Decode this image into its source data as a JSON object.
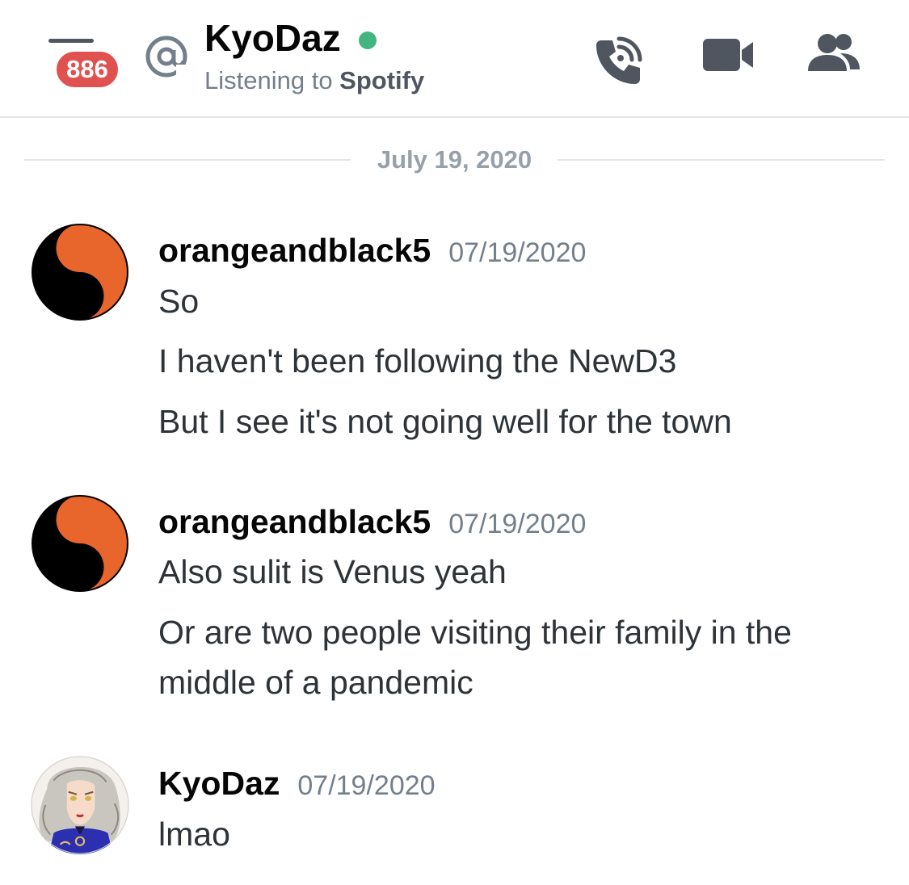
{
  "header": {
    "mention_count": "886",
    "title": "KyoDaz",
    "status_prefix": "Listening to ",
    "status_app": "Spotify",
    "status_color": "#43b581",
    "badge_color": "#e0524f",
    "icons": [
      "menu-icon",
      "at-icon",
      "phone-call-icon",
      "video-camera-icon",
      "members-icon"
    ]
  },
  "divider": {
    "date": "July 19, 2020"
  },
  "messages": [
    {
      "username": "orangeandblack5",
      "timestamp": "07/19/2020",
      "avatar": "yin-yang-orange-black",
      "lines": [
        "So",
        "I haven't been following the NewD3",
        "But I see it's not going well for the town"
      ]
    },
    {
      "username": "orangeandblack5",
      "timestamp": "07/19/2020",
      "avatar": "yin-yang-orange-black",
      "lines": [
        "Also sulit is Venus yeah",
        "Or are two people visiting their family in the",
        "middle of a pandemic"
      ]
    },
    {
      "username": "KyoDaz",
      "timestamp": "07/19/2020",
      "avatar": "anime-portrait-silver-hair",
      "lines": [
        "lmao"
      ]
    }
  ]
}
